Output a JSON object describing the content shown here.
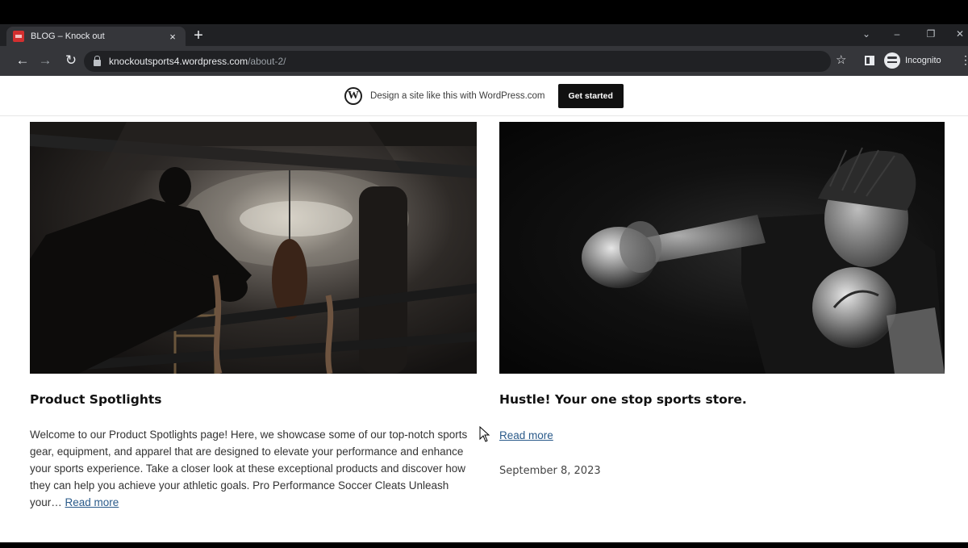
{
  "browser": {
    "tab_title": "BLOG – Knock out",
    "tab_close": "×",
    "new_tab": "+",
    "url_host": "knockoutsports4.wordpress.com",
    "url_path": "/about-2/",
    "profile_label": "Incognito",
    "window_controls": [
      "⌄",
      "–",
      "❐",
      "✕"
    ]
  },
  "wp_banner": {
    "text": "Design a site like this with WordPress.com",
    "button_label": "Get started",
    "logo": "W"
  },
  "posts": [
    {
      "title": "Product Spotlights",
      "excerpt": "Welcome to our Product Spotlights page! Here, we showcase some of our top-notch sports gear, equipment, and apparel that are designed to elevate your performance and enhance your sports experience. Take a closer look at these exceptional products and discover how they can help you achieve your athletic goals. Pro Performance Soccer Cleats  Unleash your…",
      "read_more": "Read more",
      "image": "boxer-leaning-on-ring-ropes-gym"
    },
    {
      "title": "Hustle! Your one stop sports store.",
      "read_more": "Read more",
      "date": "September 8, 2023",
      "image": "boxer-punching-black-white"
    }
  ],
  "colors": {
    "tabstrip": "#202124",
    "toolbar": "#35363a",
    "link": "#2a5a8a"
  }
}
